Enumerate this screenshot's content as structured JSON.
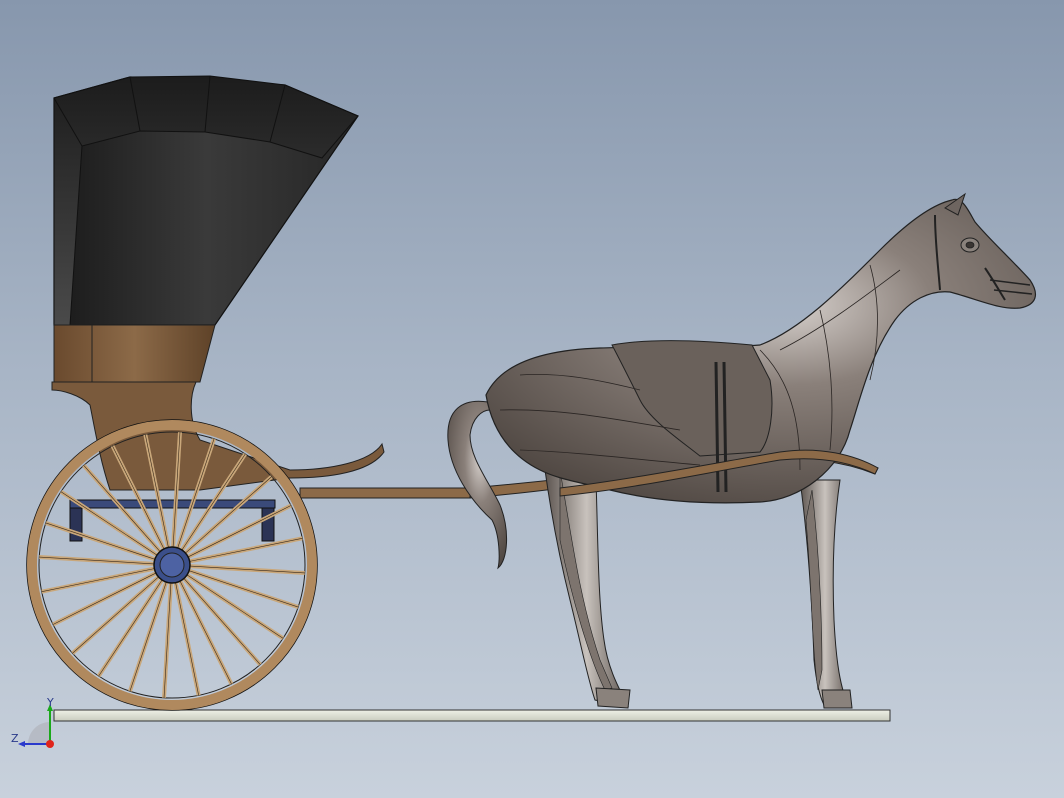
{
  "viewport": {
    "background_top": "#8797ad",
    "background_bottom": "#c8d1dc"
  },
  "model": {
    "carriage_color": "#7a5a3c",
    "hood_color": "#2e2e2e",
    "wheel_color": "#c9a77a",
    "hub_color": "#3b4f8a",
    "horse_color": "#6e6560",
    "ground_plate_color": "#dfe2d6"
  },
  "triad": {
    "y_label": "Y",
    "z_label": "Z",
    "y_color": "#1aa81a",
    "z_color": "#2a3acc",
    "x_color": "#e0241b"
  }
}
